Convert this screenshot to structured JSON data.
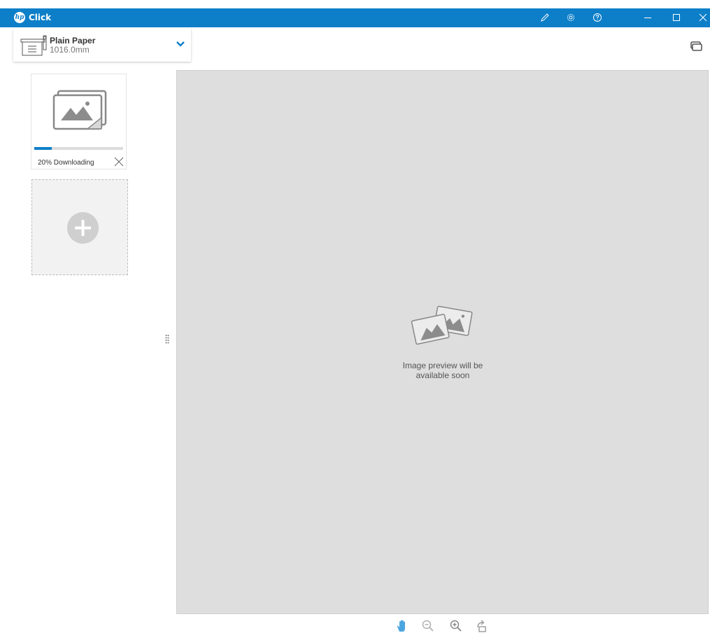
{
  "titlebar": {
    "app_name": "Click",
    "logo_text": "hp",
    "icons": [
      "edit-icon",
      "gear-icon",
      "help-icon",
      "minimize-icon",
      "maximize-icon",
      "close-icon"
    ],
    "color": "#0d7fc9"
  },
  "paper": {
    "name": "Plain Paper",
    "size": "1016.0mm",
    "icon": "printer-icon",
    "dropdown_icon": "chevron-down-icon"
  },
  "queue": {
    "icon": "print-queue-icon"
  },
  "jobs": [
    {
      "status": "20% Downloading",
      "progress_percent": 20,
      "thumb_icon": "image-stack-icon",
      "cancel_icon": "close-icon"
    }
  ],
  "add_job": {
    "icon": "plus-icon"
  },
  "preview": {
    "message_line1": "Image preview will be",
    "message_line2": "available soon",
    "icon": "images-icon",
    "background": "#dedede"
  },
  "bottom_toolbar": {
    "icons": [
      "hand-pan-icon",
      "zoom-out-icon",
      "zoom-in-icon",
      "rotate-icon"
    ]
  }
}
